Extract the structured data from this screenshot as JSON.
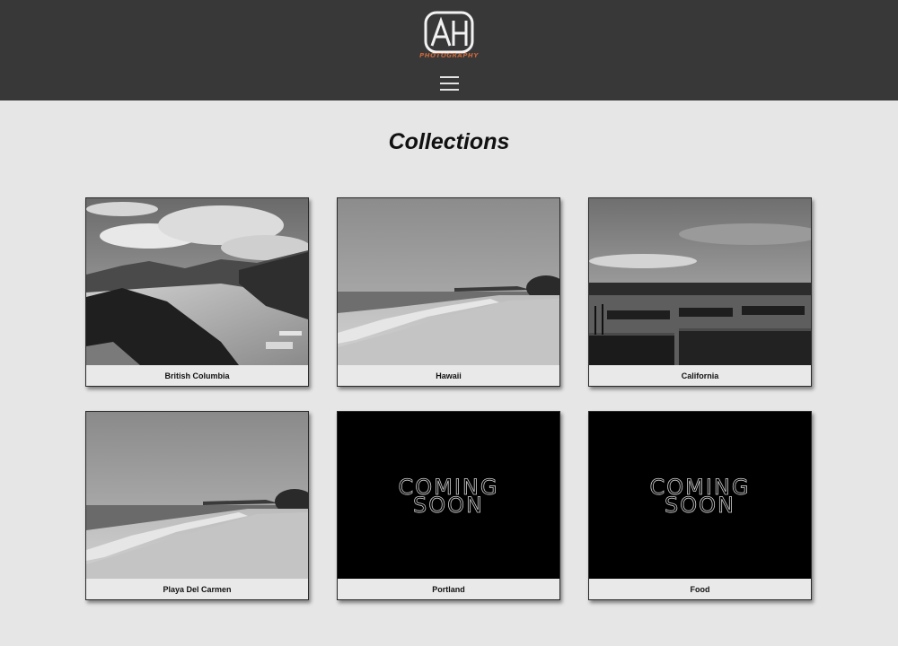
{
  "header": {
    "logo_text": "AH",
    "logo_subtitle": "PHOTOGRAPHY",
    "accent_color": "#c7673c",
    "menu_icon": "hamburger-menu-icon"
  },
  "main": {
    "title": "Collections",
    "collections": [
      {
        "label": "British Columbia",
        "thumbnail": "mountains-river-photo"
      },
      {
        "label": "Hawaii",
        "thumbnail": "beach-photo"
      },
      {
        "label": "California",
        "thumbnail": "pier-docks-photo"
      },
      {
        "label": "Playa Del Carmen",
        "thumbnail": "beach-photo"
      },
      {
        "label": "Portland",
        "coming_soon": [
          "COMING",
          "SOON"
        ]
      },
      {
        "label": "Food",
        "coming_soon": [
          "COMING",
          "SOON"
        ]
      }
    ]
  }
}
